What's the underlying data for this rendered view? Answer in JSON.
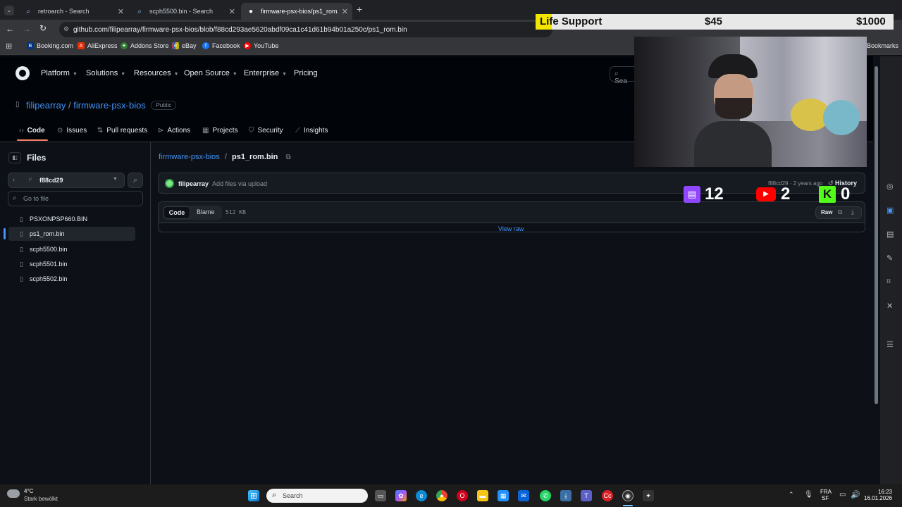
{
  "browser": {
    "tabs": [
      {
        "label": "retroarch - Search"
      },
      {
        "label": "scph5500.bin - Search"
      },
      {
        "label": "firmware-psx-bios/ps1_rom.bin"
      }
    ],
    "new_tab": "+",
    "url": "github.com/filipearray/firmware-psx-bios/blob/f88cd293ae5620abdf09ca1c41d61b94b01a250c/ps1_rom.bin",
    "bookmarks": [
      "Booking.com",
      "AliExpress",
      "Addons Store",
      "eBay",
      "Facebook",
      "YouTube"
    ],
    "all_bookmarks": "Bookmarks"
  },
  "github": {
    "nav": [
      "Platform",
      "Solutions",
      "Resources",
      "Open Source",
      "Enterprise",
      "Pricing"
    ],
    "search_placeholder": "Sea",
    "owner": "filipearray",
    "separator": "/",
    "repo": "firmware-psx-bios",
    "visibility": "Public",
    "repo_tabs": [
      "Code",
      "Issues",
      "Pull requests",
      "Actions",
      "Projects",
      "Security",
      "Insights"
    ],
    "files_heading": "Files",
    "branch": "f88cd29",
    "go_to_file": "Go to file",
    "files": [
      "PSXONPSP660.BIN",
      "ps1_rom.bin",
      "scph5500.bin",
      "scph5501.bin",
      "scph5502.bin"
    ],
    "breadcrumb_repo": "firmware-psx-bios",
    "breadcrumb_file": "ps1_rom.bin",
    "commit_author": "filipearray",
    "commit_message": "Add files via upload",
    "commit_meta": "f88cd29 · 2 years ago",
    "history_label": "History",
    "code_tab": "Code",
    "blame_tab": "Blame",
    "file_size": "512 KB",
    "raw_label": "Raw",
    "view_raw": "View raw"
  },
  "overlay": {
    "goal_label": "Life Support",
    "current_amount": "$45",
    "goal_amount": "$1000",
    "twitch_count": "12",
    "youtube_count": "2",
    "kick_count": "0"
  },
  "taskbar": {
    "temperature": "4°C",
    "weather": "Stark bewölkt",
    "search": "Search",
    "lang_top": "FRA",
    "lang_bottom": "SF",
    "time": "16:23",
    "date": "16.01.2026"
  },
  "colors": {
    "bg": "#0d1117",
    "link": "#4493f8",
    "accent_underline": "#f78166"
  }
}
